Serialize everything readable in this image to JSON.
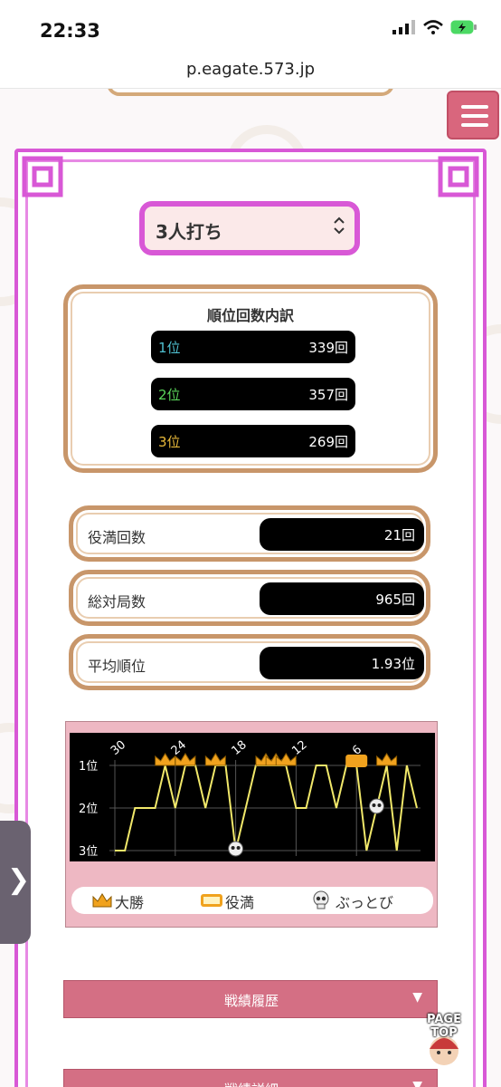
{
  "status_bar": {
    "time": "22:33"
  },
  "browser": {
    "url": "p.eagate.573.jp"
  },
  "mode_select": {
    "selected": "3人打ち"
  },
  "rank_breakdown": {
    "title": "順位回数内訳",
    "rows": [
      {
        "label": "1位",
        "value": "339回",
        "color": "#4fc0d0"
      },
      {
        "label": "2位",
        "value": "357回",
        "color": "#5ad65a"
      },
      {
        "label": "3位",
        "value": "269回",
        "color": "#e8b93a"
      }
    ]
  },
  "stats": [
    {
      "label": "役満回数",
      "value": "21回"
    },
    {
      "label": "総対局数",
      "value": "965回"
    },
    {
      "label": "平均順位",
      "value": "1.93位"
    }
  ],
  "chart_data": {
    "type": "line",
    "x_tick_labels": [
      "30",
      "24",
      "18",
      "12",
      "6"
    ],
    "y_tick_labels": [
      "1位",
      "2位",
      "3位"
    ],
    "ylim": [
      3,
      1
    ],
    "values": [
      3,
      3,
      2,
      2,
      2,
      1,
      2,
      1,
      1,
      2,
      1,
      1,
      3,
      2,
      1,
      1,
      1,
      1,
      2,
      2,
      1,
      1,
      2,
      1,
      1,
      3,
      2,
      1,
      3,
      1,
      2
    ],
    "markers": {
      "win": [
        5,
        7,
        10,
        15,
        16,
        17,
        27
      ],
      "yakuman": [
        24
      ],
      "bust": [
        12,
        26
      ]
    },
    "line_color": "#f1e86a"
  },
  "legend": {
    "win": "大勝",
    "yakuman": "役満",
    "bust": "ぶっとび"
  },
  "accordions": [
    {
      "label": "戦績履歴",
      "arrow": "▼"
    },
    {
      "label": "戦績詳細",
      "arrow": "▼"
    }
  ],
  "side_tab": {
    "glyph": "❯"
  },
  "page_top": {
    "label": "PAGE TOP"
  }
}
